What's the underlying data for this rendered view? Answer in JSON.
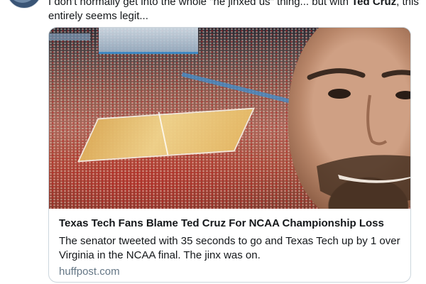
{
  "tweet": {
    "text_line_1_pre": "I don't normally get into the whole \"he jinxed us\" thing... but with ",
    "text_line_1_bold": "Ted Cruz",
    "text_line_1_post": ", this",
    "text_line_2": "entirely seems legit..."
  },
  "card": {
    "title": "Texas Tech Fans Blame Ted Cruz For NCAA Championship Loss",
    "description_line_1": "The senator tweeted with 35 seconds to go and Texas Tech up by 1 over",
    "description_line_2": "Virginia in the NCAA final. The jinx was on.",
    "domain": "huffpost.com",
    "image_icon": "stadium-selfie-photo"
  },
  "colors": {
    "text": "#14171a",
    "muted": "#657786",
    "border": "#ccd6dd"
  }
}
